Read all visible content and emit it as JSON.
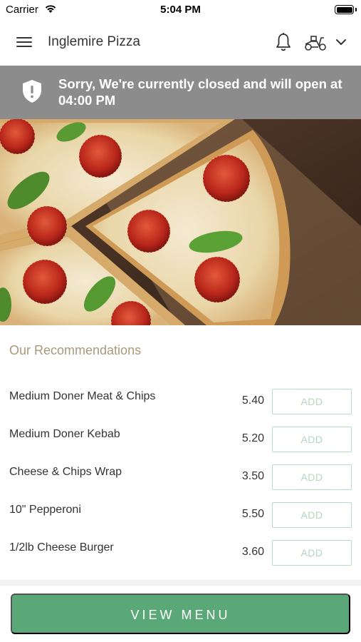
{
  "status_bar": {
    "carrier": "Carrier",
    "time": "5:04 PM",
    "wifi_icon": "wifi-icon",
    "battery_icon": "battery-icon"
  },
  "header": {
    "title": "Inglemire Pizza",
    "menu_icon": "hamburger-menu-icon",
    "bell_icon": "bell-icon",
    "delivery_icon": "scooter-icon",
    "dropdown_icon": "chevron-down-icon"
  },
  "banner": {
    "icon": "shield-alert-icon",
    "text": "Sorry, We're currently closed and will open at 04:00 PM"
  },
  "hero": {
    "image": "pizza-photo"
  },
  "recommendations": {
    "heading": "Our Recommendations",
    "add_label": "ADD",
    "items": [
      {
        "name": "Medium Doner Meat & Chips",
        "price": "5.40"
      },
      {
        "name": "Medium Doner Kebab",
        "price": "5.20"
      },
      {
        "name": "Cheese & Chips Wrap",
        "price": "3.50"
      },
      {
        "name": "10\" Pepperoni",
        "price": "5.50"
      },
      {
        "name": "1/2lb Cheese Burger",
        "price": "3.60"
      }
    ]
  },
  "footer": {
    "view_menu_label": "VIEW MENU"
  },
  "colors": {
    "accent_green": "#5aa877",
    "banner_grey": "#8c8c8c",
    "heading_tan": "#a8997a",
    "add_border": "#b5dcc5"
  }
}
